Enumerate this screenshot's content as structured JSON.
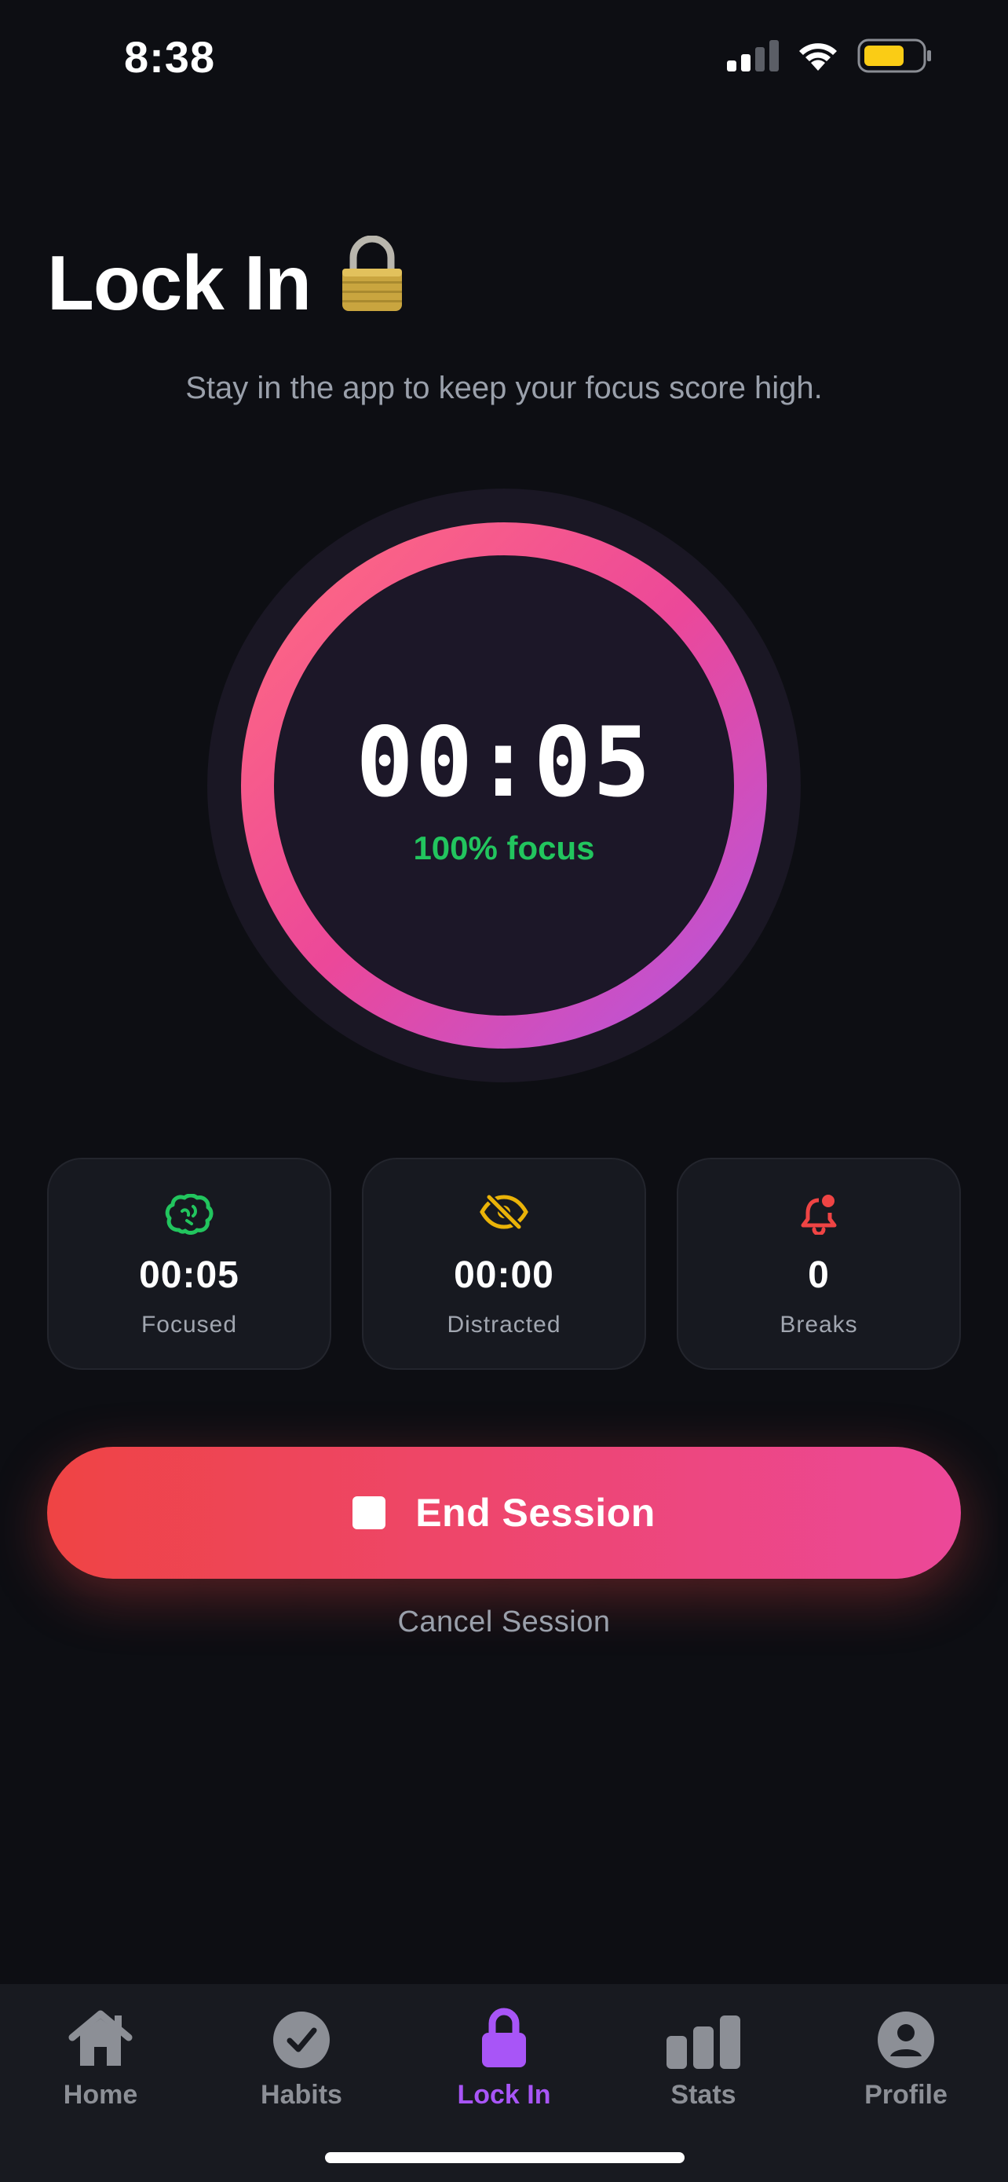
{
  "status_bar": {
    "time": "8:38"
  },
  "header": {
    "title": "Lock In",
    "subtitle": "Stay in the app to keep your focus score high."
  },
  "timer": {
    "time": "00:05",
    "focus_label": "100% focus",
    "progress": 1.0
  },
  "stats": [
    {
      "icon": "brain-icon",
      "value": "00:05",
      "label": "Focused",
      "color": "#22c55e"
    },
    {
      "icon": "eye-off-icon",
      "value": "00:00",
      "label": "Distracted",
      "color": "#eab308"
    },
    {
      "icon": "bell-icon",
      "value": "0",
      "label": "Breaks",
      "color": "#ef4444"
    }
  ],
  "actions": {
    "end_label": "End Session",
    "cancel_label": "Cancel Session"
  },
  "tabs": [
    {
      "icon": "home-icon",
      "label": "Home",
      "active": false
    },
    {
      "icon": "check-circle-icon",
      "label": "Habits",
      "active": false
    },
    {
      "icon": "lock-icon",
      "label": "Lock In",
      "active": true
    },
    {
      "icon": "bar-chart-icon",
      "label": "Stats",
      "active": false
    },
    {
      "icon": "profile-icon",
      "label": "Profile",
      "active": false
    }
  ],
  "colors": {
    "background": "#0d0e13",
    "accent": "#a855f7",
    "ring_start": "#ff6b81",
    "ring_mid": "#ec4899",
    "ring_end": "#b455e0",
    "focus_green": "#22c55e",
    "danger": "#ef4444",
    "battery": "#facc15"
  }
}
